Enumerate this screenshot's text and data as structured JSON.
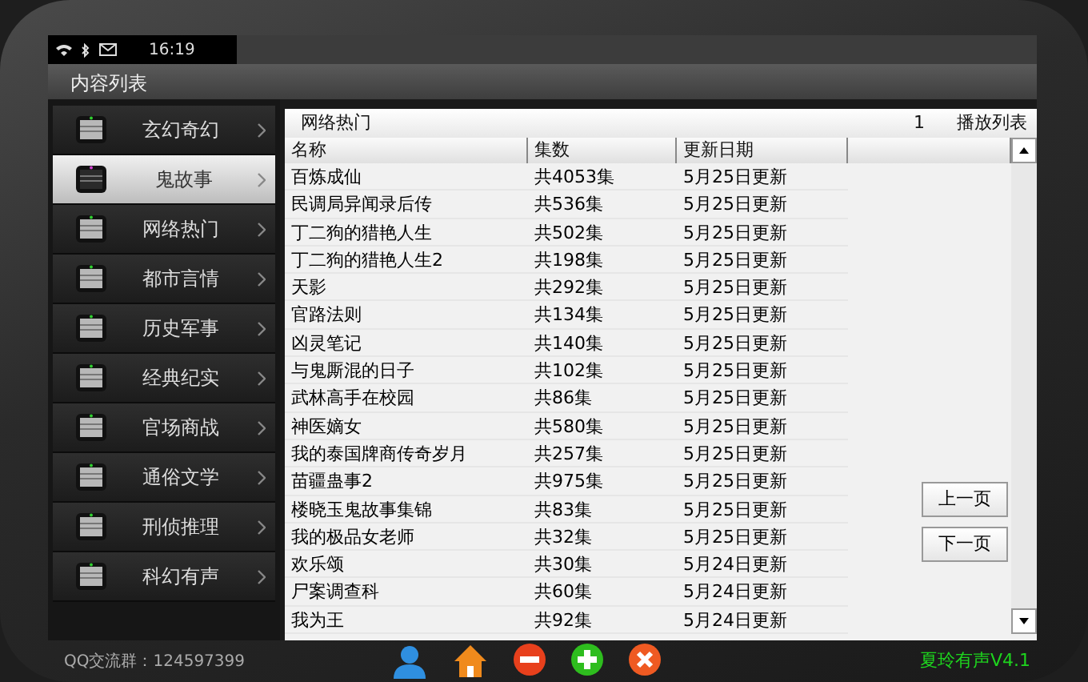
{
  "status_bar": {
    "time": "16:19"
  },
  "window": {
    "title": "内容列表"
  },
  "sidebar": {
    "items": [
      {
        "label": "玄幻奇幻",
        "selected": false
      },
      {
        "label": "鬼故事",
        "selected": true
      },
      {
        "label": "网络热门",
        "selected": false
      },
      {
        "label": "都市言情",
        "selected": false
      },
      {
        "label": "历史军事",
        "selected": false
      },
      {
        "label": "经典纪实",
        "selected": false
      },
      {
        "label": "官场商战",
        "selected": false
      },
      {
        "label": "通俗文学",
        "selected": false
      },
      {
        "label": "刑侦推理",
        "selected": false
      },
      {
        "label": "科幻有声",
        "selected": false
      }
    ]
  },
  "list": {
    "title": "网络热门",
    "page": "1",
    "playlist_label": "播放列表",
    "columns": [
      "名称",
      "集数",
      "更新日期"
    ],
    "rows": [
      [
        "百炼成仙",
        "共4053集",
        "5月25日更新"
      ],
      [
        "民调局异闻录后传",
        "共536集",
        "5月25日更新"
      ],
      [
        "丁二狗的猎艳人生",
        "共502集",
        "5月25日更新"
      ],
      [
        "丁二狗的猎艳人生2",
        "共198集",
        "5月25日更新"
      ],
      [
        "天影",
        "共292集",
        "5月25日更新"
      ],
      [
        "官路法则",
        "共134集",
        "5月25日更新"
      ],
      [
        "凶灵笔记",
        "共140集",
        "5月25日更新"
      ],
      [
        "与鬼厮混的日子",
        "共102集",
        "5月25日更新"
      ],
      [
        "武林高手在校园",
        "共86集",
        "5月25日更新"
      ],
      [
        "神医嫡女",
        "共580集",
        "5月25日更新"
      ],
      [
        "我的泰国牌商传奇岁月",
        "共257集",
        "5月25日更新"
      ],
      [
        "苗疆蛊事2",
        "共975集",
        "5月25日更新"
      ],
      [
        "楼晓玉鬼故事集锦",
        "共83集",
        "5月25日更新"
      ],
      [
        "我的极品女老师",
        "共32集",
        "5月25日更新"
      ],
      [
        "欢乐颂",
        "共30集",
        "5月24日更新"
      ],
      [
        "尸案调查科",
        "共60集",
        "5月24日更新"
      ],
      [
        "我为王",
        "共92集",
        "5月24日更新"
      ]
    ]
  },
  "pager": [
    "上一页",
    "下一页"
  ],
  "footer": {
    "qq_group": "QQ交流群：124597399",
    "version": "夏玲有声V4.1"
  }
}
